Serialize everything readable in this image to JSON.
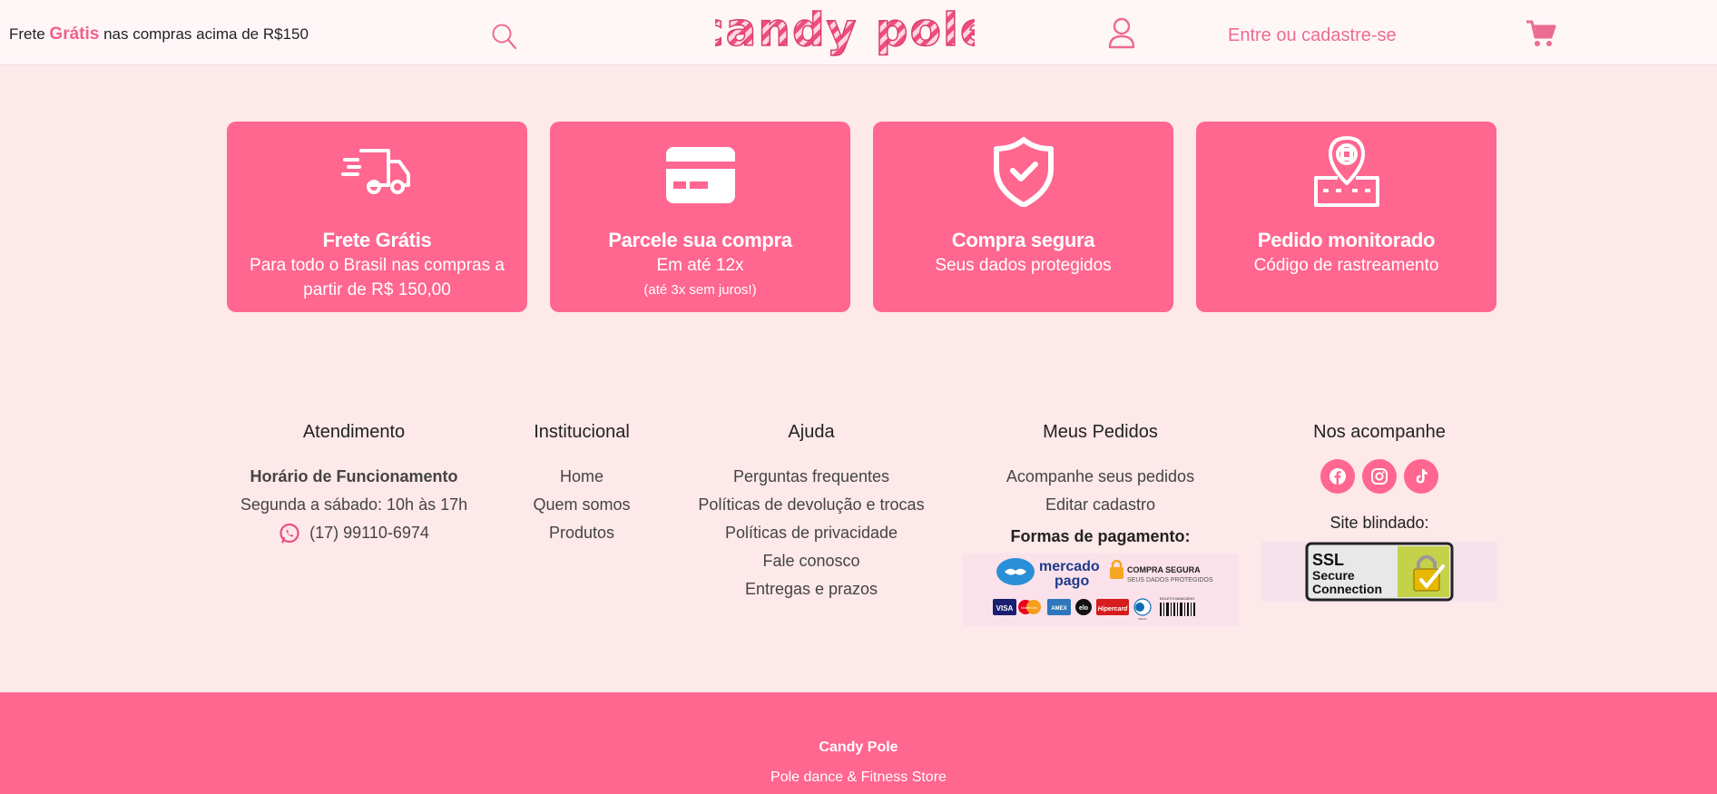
{
  "header": {
    "promo_prefix": "Frete",
    "promo_highlight": "Grátis",
    "promo_suffix": "nas compras acima de R$150",
    "logo_text": "candy pole",
    "login_label": "Entre ou cadastre-se",
    "icons": [
      "search-icon",
      "user-icon",
      "cart-icon"
    ]
  },
  "features": [
    {
      "icon": "truck-icon",
      "title": "Frete Grátis",
      "sub": "Para todo o Brasil nas compras a partir de R$ 150,00",
      "note": ""
    },
    {
      "icon": "credit-card-icon",
      "title": "Parcele sua compra",
      "sub": "Em até 12x",
      "note": "(até 3x sem juros!)"
    },
    {
      "icon": "shield-check-icon",
      "title": "Compra segura",
      "sub": "Seus dados protegidos",
      "note": ""
    },
    {
      "icon": "map-pin-icon",
      "title": "Pedido monitorado",
      "sub": "Código de rastreamento",
      "note": ""
    }
  ],
  "footer": {
    "atendimento": {
      "title": "Atendimento",
      "hours_title": "Horário de Funcionamento",
      "hours": "Segunda a sábado: 10h às 17h",
      "phone": "(17) 99110-6974"
    },
    "institucional": {
      "title": "Institucional",
      "links": [
        "Home",
        "Quem somos",
        "Produtos"
      ]
    },
    "ajuda": {
      "title": "Ajuda",
      "links": [
        "Perguntas frequentes",
        "Políticas de devolução e trocas",
        "Políticas de privacidade",
        "Fale conosco",
        "Entregas e prazos"
      ]
    },
    "pedidos": {
      "title": "Meus Pedidos",
      "links": [
        "Acompanhe seus pedidos",
        "Editar cadastro"
      ],
      "payment_label": "Formas de pagamento:",
      "payment_brand_top": "mercado",
      "payment_brand_bottom": "pago",
      "secure_title": "COMPRA SEGURA",
      "secure_sub": "SEUS DADOS PROTEGIDOS",
      "cards": [
        "VISA",
        "MasterCard",
        "AMEX",
        "elo",
        "Hipercard",
        "Diners",
        "BOLETO BANCÁRIO"
      ]
    },
    "social": {
      "title": "Nos acompanhe",
      "networks": [
        "facebook-icon",
        "instagram-icon",
        "tiktok-icon"
      ],
      "blind_label": "Site blindado:",
      "ssl_l1": "SSL",
      "ssl_l2": "Secure",
      "ssl_l3": "Connection"
    }
  },
  "bottom": {
    "name": "Candy Pole",
    "tagline": "Pole dance & Fitness Store"
  },
  "colors": {
    "brand_pink": "#ff6690",
    "bg": "#fde8ea",
    "header_bg": "#fff6f8",
    "link_pink": "#ec6b92"
  }
}
